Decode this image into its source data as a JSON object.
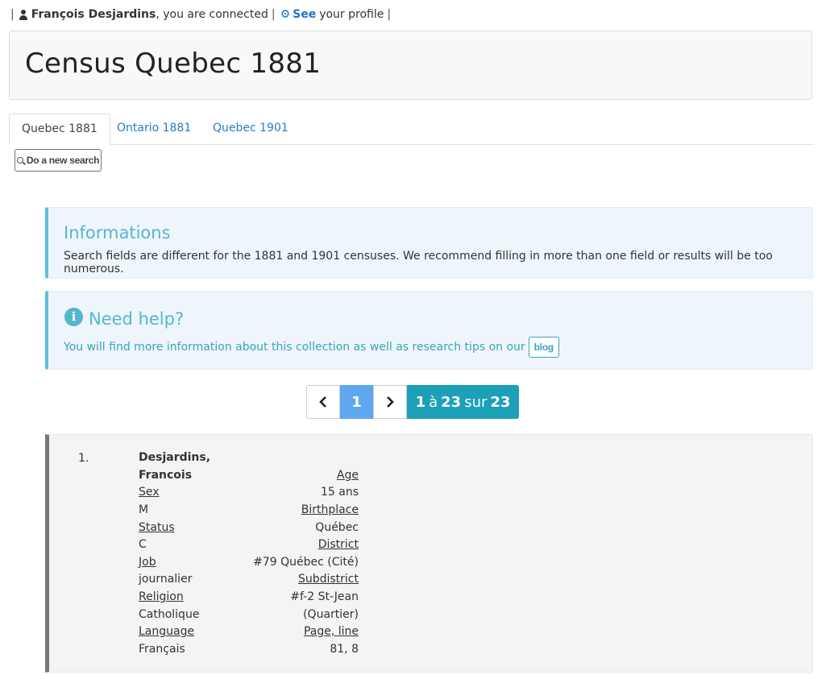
{
  "topbar": {
    "sep": "|",
    "user_name": "François Desjardins",
    "connected_text": ", you are connected",
    "profile_link": "See",
    "profile_text": "your profile"
  },
  "page": {
    "title": "Census Quebec 1881"
  },
  "tabs": [
    {
      "label": "Quebec 1881",
      "active": true
    },
    {
      "label": "Ontario 1881",
      "active": false
    },
    {
      "label": "Quebec 1901",
      "active": false
    }
  ],
  "new_search_label": "Do a new search",
  "informations": {
    "title": "Informations",
    "text": "Search fields are different for the 1881 and 1901 censuses. We recommend filling in more than one field or results will be too numerous."
  },
  "help": {
    "title": "Need help?",
    "text": "You will find more information about this collection as well as research tips on our",
    "blog_label": "blog"
  },
  "pagination": {
    "prev": "<",
    "current": "1",
    "next": ">",
    "from": "1",
    "to_word": "à",
    "to": "23",
    "of_word": "sur",
    "total": "23"
  },
  "result": {
    "index": "1.",
    "name_line1": "Desjardins,",
    "name_line2": "Francois",
    "left_fields": [
      {
        "label": "Sex",
        "value": "M"
      },
      {
        "label": "Status",
        "value": "C"
      },
      {
        "label": "Job",
        "value": "journalier"
      },
      {
        "label": "Religion",
        "value": "Catholique"
      },
      {
        "label": "Language",
        "value": "Français"
      }
    ],
    "right_fields": {
      "age_label": "Age",
      "age_value": "15 ans",
      "birthplace_label": "Birthplace",
      "birthplace_value": "Québec",
      "district_label": "District",
      "district_value": "#79 Québec (Cité)",
      "subdistrict_label": "Subdistrict",
      "subdistrict_value_1": "#f-2 St-Jean",
      "subdistrict_value_2": "(Quartier)",
      "page_line_label": "Page, line",
      "page_line_value": "81, 8"
    }
  }
}
